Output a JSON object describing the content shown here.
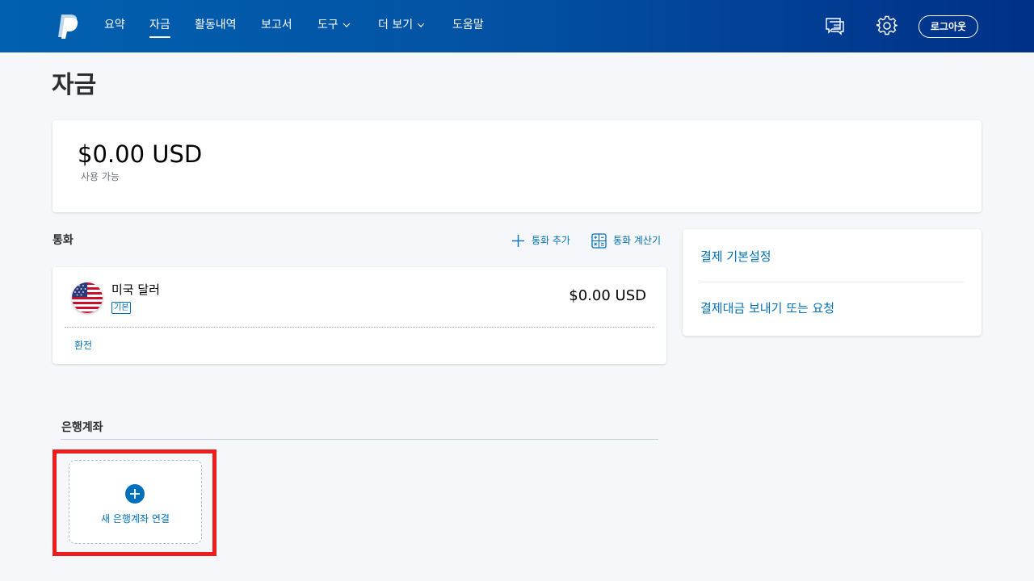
{
  "nav": {
    "items": [
      {
        "label": "요약"
      },
      {
        "label": "자금"
      },
      {
        "label": "활동내역"
      },
      {
        "label": "보고서"
      },
      {
        "label": "도구"
      },
      {
        "label": "더 보기"
      },
      {
        "label": "도움말"
      }
    ],
    "active": "자금",
    "logout_label": "로그아웃",
    "icons": {
      "logo": "paypal-logo-icon",
      "messages": "message-center-icon",
      "settings": "gear-icon"
    }
  },
  "page": {
    "title": "자금"
  },
  "balance": {
    "amount": "$0.00 USD",
    "label": "사용 가능"
  },
  "currency_section": {
    "title": "통화",
    "add_currency": "통화 추가",
    "calculator": "통화 계산기",
    "items": [
      {
        "name": "미국 달러",
        "badge": "기본",
        "amount": "$0.00 USD",
        "flag": "us-flag-icon"
      }
    ],
    "convert_label": "환전"
  },
  "side_links": [
    {
      "label": "결제 기본설정"
    },
    {
      "label": "결제대금 보내기 또는 요청"
    }
  ],
  "bank_section": {
    "title": "은행계좌",
    "add_label": "새 은행계좌 연결"
  },
  "colors": {
    "brand_blue": "#0070ba",
    "nav_dark": "#003087",
    "highlight": "#ee1c1c"
  }
}
